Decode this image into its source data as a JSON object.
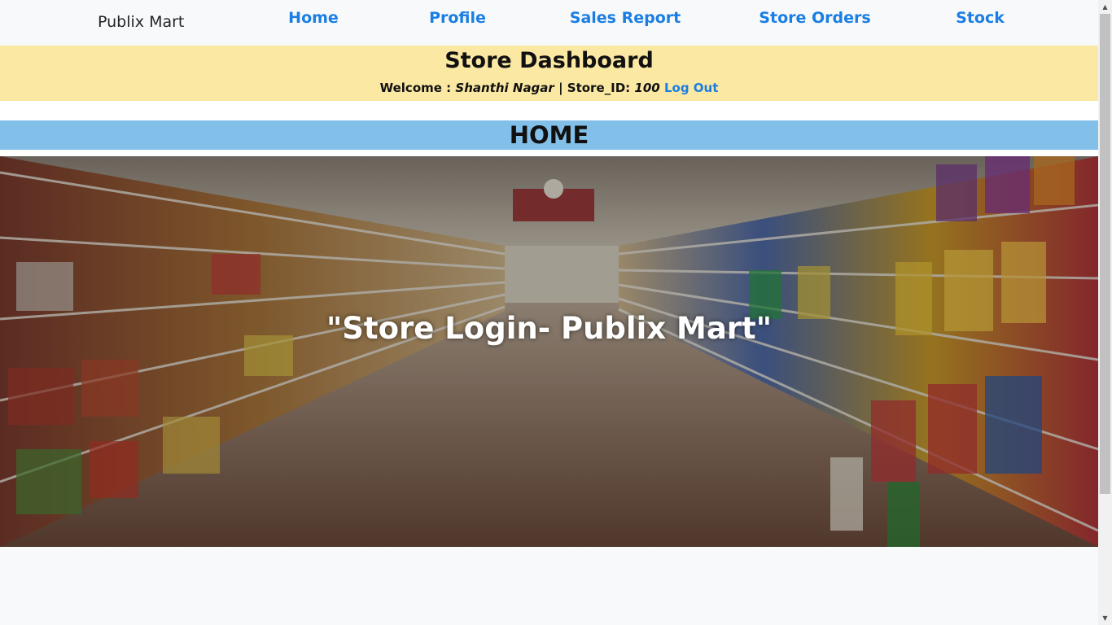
{
  "navbar": {
    "brand": "Publix Mart",
    "links": [
      {
        "label": "Home"
      },
      {
        "label": "Profile"
      },
      {
        "label": "Sales Report"
      },
      {
        "label": "Store Orders"
      },
      {
        "label": "Stock"
      }
    ]
  },
  "dashboard": {
    "title": "Store Dashboard",
    "welcome_label": "Welcome :",
    "store_name": "Shanthi Nagar",
    "separator": "|",
    "store_id_label": "Store_ID:",
    "store_id": "100",
    "logout_label": "Log Out"
  },
  "section": {
    "heading": "HOME"
  },
  "hero": {
    "caption": "\"Store Login- Publix Mart\""
  },
  "colors": {
    "link": "#1a7ee3",
    "header_bg": "#fbe8a3",
    "section_bg": "#82bfe9"
  },
  "icons": {
    "scroll_up": "scroll-up-arrow-icon",
    "scroll_down": "scroll-down-arrow-icon"
  }
}
